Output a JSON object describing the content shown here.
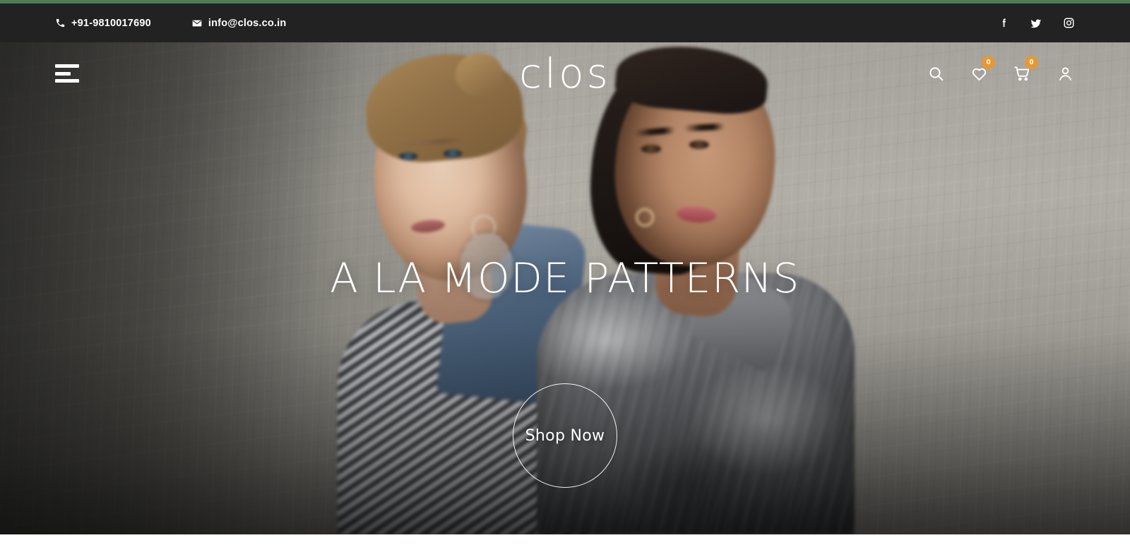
{
  "topbar": {
    "phone": "+91-9810017690",
    "phone_icon": "phone-icon",
    "email": "info@clos.co.in",
    "email_icon": "mail-icon",
    "background_color": "#222222",
    "socials": [
      {
        "name": "facebook",
        "label": "Facebook"
      },
      {
        "name": "twitter",
        "label": "Twitter"
      },
      {
        "name": "instagram",
        "label": "Instagram"
      }
    ]
  },
  "accent": {
    "color": "#4d7c55"
  },
  "header": {
    "menu_icon": "hamburger-menu-icon",
    "logo_text": "clos",
    "actions": {
      "search_icon": "search-icon",
      "wishlist_icon": "heart-icon",
      "wishlist_count": "0",
      "cart_icon": "shopping-cart-icon",
      "cart_count": "0",
      "account_icon": "user-account-icon",
      "badge_color": "#e39a34"
    }
  },
  "hero": {
    "title": "A LA MODE PATTERNS",
    "cta_label": "Shop Now",
    "image_alt": "Two female models standing back to back against a textured plaster wall"
  }
}
